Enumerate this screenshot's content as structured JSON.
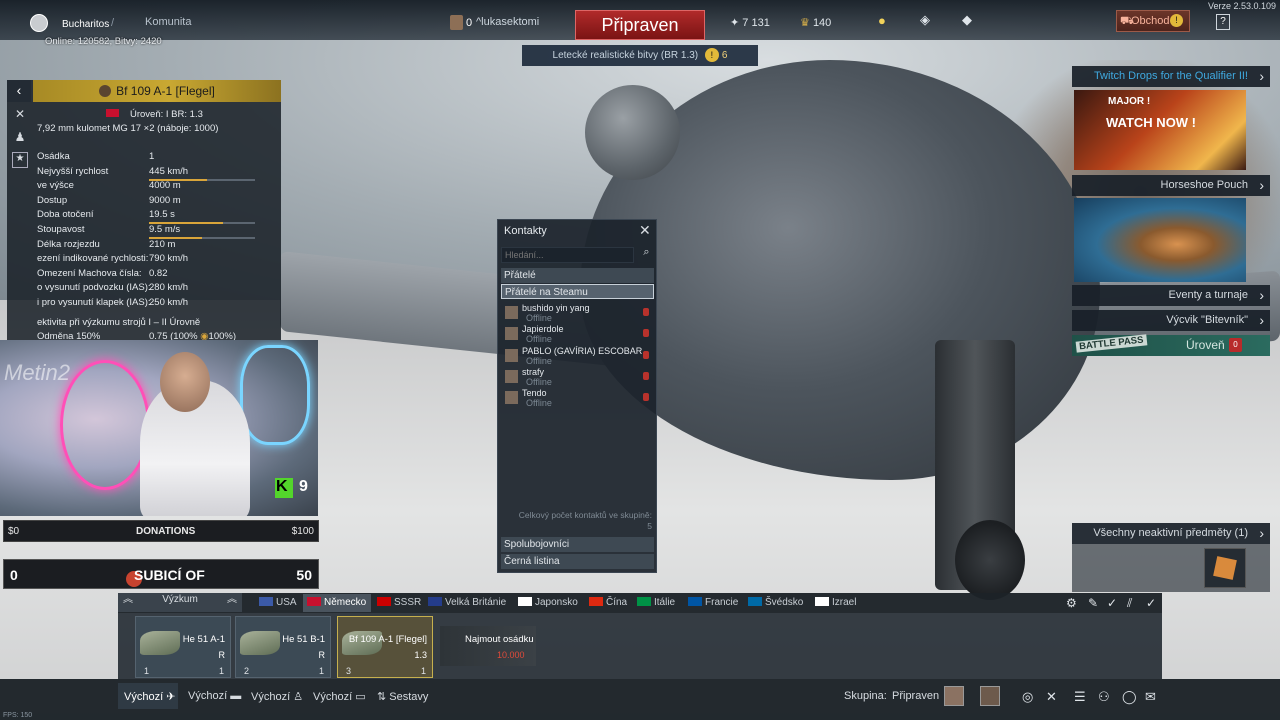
{
  "topbar": {
    "username": "Bucharitos",
    "community": "Komunita",
    "online_stats": "Online: 120582, Bitvy: 2420",
    "squad_count": "0",
    "squad_member": "lukasektomi",
    "ready_label": "Připraven",
    "mode_label": "Letecké realistické bitvy (BR 1.3)",
    "mode_badge": "!",
    "mode_count": "6",
    "silver_lions": "7 131",
    "golden_eagles": "140",
    "shop_label": "Obchod",
    "shop_badge": "!",
    "help": "?",
    "version": "Verze 2.53.0.109"
  },
  "vehicle": {
    "title": "Bf 109 A-1 [Flegel]",
    "rank_line": "Úroveň: I    BR: 1.3",
    "armament": "7,92 mm kulomet MG 17 ×2 (náboje: 1000)",
    "stats": [
      {
        "label": "Osádka",
        "value": "1",
        "bar": null
      },
      {
        "label": "Nejvyšší rychlost",
        "value": "445 km/h",
        "bar": 0.55
      },
      {
        "label": "ve výšce",
        "value": "4000 m",
        "bar": null
      },
      {
        "label": "Dostup",
        "value": "9000 m",
        "bar": null
      },
      {
        "label": "Doba otočení",
        "value": "19.5 s",
        "bar": 0.7
      },
      {
        "label": "Stoupavost",
        "value": "9.5 m/s",
        "bar": 0.5
      },
      {
        "label": "Délka rozjezdu",
        "value": "210 m",
        "bar": null
      },
      {
        "label": "ezení indikované rychlosti:",
        "value": "790 km/h",
        "bar": null
      },
      {
        "label": "Omezení Machova čísla:",
        "value": "0.82",
        "bar": null
      },
      {
        "label": "o vysunutí podvozku (IAS):",
        "value": "280 km/h",
        "bar": null
      },
      {
        "label": "i pro vysunutí klapek (IAS):",
        "value": "250 km/h",
        "bar": null
      }
    ],
    "research_line": "ektivita při výzkumu strojů I – II Úrovně",
    "reward_label": "Odměna",
    "reward_value": "150%",
    "reward_right": "0.75 (100%",
    "reward_right2": "100%)"
  },
  "stream": {
    "watermark": "Metin2",
    "k_label": "K",
    "k_count": "9",
    "don_left": "$0",
    "don_label": "DONATIONS",
    "don_right": "$100",
    "sub_left": "0",
    "sub_label": "SUBICÍ OF",
    "sub_right": "50"
  },
  "contacts": {
    "title": "Kontakty",
    "search_placeholder": "Hledání...",
    "groups": [
      "Přátelé",
      "Přátelé na Steamu"
    ],
    "items": [
      {
        "name": "bushido yin yang",
        "status": "Offline"
      },
      {
        "name": "Japierdole",
        "status": "Offline"
      },
      {
        "name": "PABLO (GAVÍRIA) ESCOBAR",
        "status": "Offline"
      },
      {
        "name": "strafy",
        "status": "Offline"
      },
      {
        "name": "Tendo",
        "status": "Offline"
      }
    ],
    "total_label": "Celkový počet kontaktů ve skupině:",
    "total_value": "5",
    "bottom_groups": [
      "Spolubojovníci",
      "Černá listina"
    ]
  },
  "right_panel": {
    "twitch": "Twitch Drops for the Qualifier II!",
    "promo_major": "MAJOR !",
    "promo_watch": "WATCH NOW !",
    "horseshoe": "Horseshoe Pouch",
    "events": "Eventy a turnaje",
    "training": "Výcvik \"Bitevník\"",
    "battle_pass_logo": "BATTLE PASS",
    "level_label": "Úroveň",
    "level_badge": "0",
    "inactive": "Všechny neaktivní předměty (1)"
  },
  "nations": {
    "research_label": "Výzkum",
    "list": [
      {
        "name": "USA",
        "color": "#3b5aa8"
      },
      {
        "name": "Německo",
        "color": "#c8102e"
      },
      {
        "name": "SSSR",
        "color": "#cc0000"
      },
      {
        "name": "Velká Británie",
        "color": "#243c8a"
      },
      {
        "name": "Japonsko",
        "color": "#ffffff"
      },
      {
        "name": "Čína",
        "color": "#de2910"
      },
      {
        "name": "Itálie",
        "color": "#009246"
      },
      {
        "name": "Francie",
        "color": "#0055a4"
      },
      {
        "name": "Švédsko",
        "color": "#006aa7"
      },
      {
        "name": "Izrael",
        "color": "#ffffff"
      }
    ]
  },
  "slots": [
    {
      "name": "He 51 A-1",
      "rank": "R",
      "crew": "1",
      "level": "1"
    },
    {
      "name": "He 51 B-1",
      "rank": "R",
      "crew": "2",
      "level": "1"
    },
    {
      "name": "Bf 109 A-1 [Flegel]",
      "rank": "1.3",
      "crew": "3",
      "level": "1"
    }
  ],
  "hire": {
    "label": "Najmout osádku",
    "price": "10.000"
  },
  "bottombar": {
    "presets": [
      "Výchozí",
      "Výchozí",
      "Výchozí",
      "Výchozí"
    ],
    "sets": "Sestavy",
    "squad_label": "Skupina:",
    "squad_status": "Připraven",
    "fps": "FPS: 150"
  }
}
